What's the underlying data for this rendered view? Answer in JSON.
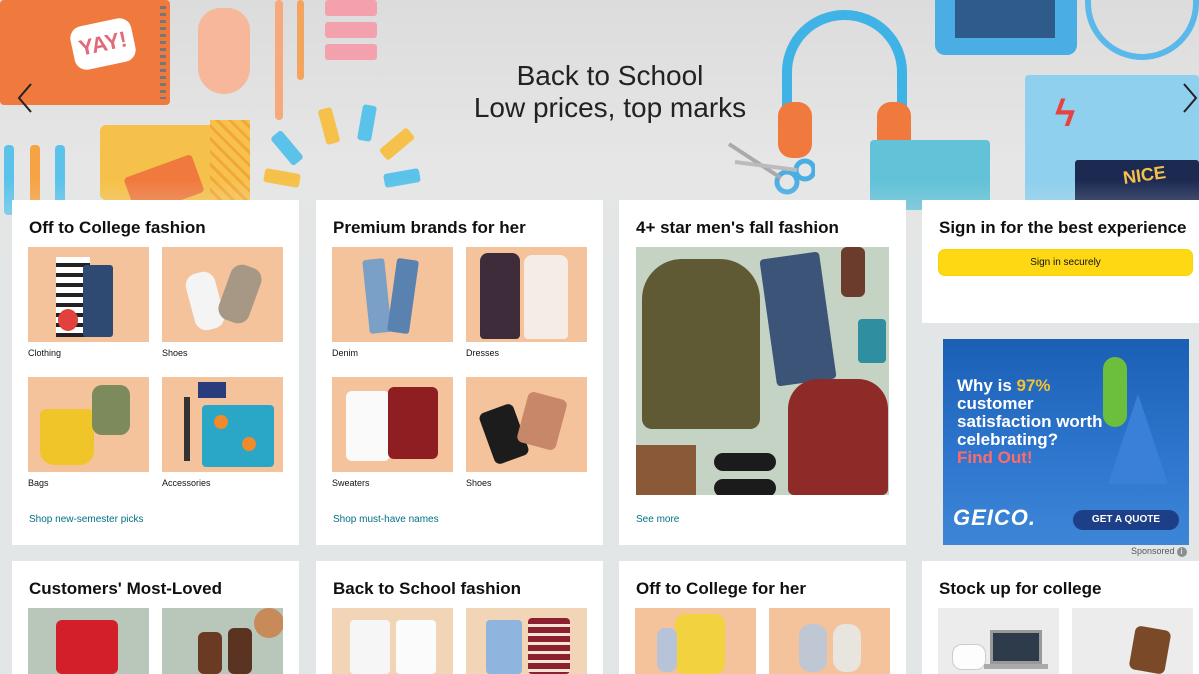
{
  "hero": {
    "title_line1": "Back to School",
    "title_line2": "Low prices, top marks",
    "prev_icon": "chevron-left-icon",
    "next_icon": "chevron-right-icon"
  },
  "cards_row1": [
    {
      "title": "Off to College fashion",
      "items": [
        "Clothing",
        "Shoes",
        "Bags",
        "Accessories"
      ],
      "link": "Shop new-semester picks"
    },
    {
      "title": "Premium brands for her",
      "items": [
        "Denim",
        "Dresses",
        "Sweaters",
        "Shoes"
      ],
      "link": "Shop must-have names"
    },
    {
      "title": "4+ star men's fall fashion",
      "link": "See more"
    },
    {
      "title": "Sign in for the best experience",
      "button": "Sign in securely"
    }
  ],
  "ad": {
    "line_pre": "Why is ",
    "highlight": "97%",
    "line_post": " customer satisfaction worth celebrating?",
    "cta_text": "Find Out!",
    "logo": "GEICO.",
    "button": "GET A QUOTE",
    "sponsored": "Sponsored",
    "colors": {
      "background": "#1a5fb4",
      "highlight": "#f2c230",
      "cta": "#ff6b6b"
    }
  },
  "cards_row2": [
    {
      "title": "Customers' Most-Loved"
    },
    {
      "title": "Back to School fashion"
    },
    {
      "title": "Off to College for her"
    },
    {
      "title": "Stock up for college"
    }
  ],
  "colors": {
    "page_bg": "#e3e6e6",
    "link": "#007185",
    "signin_button": "#ffd814"
  }
}
